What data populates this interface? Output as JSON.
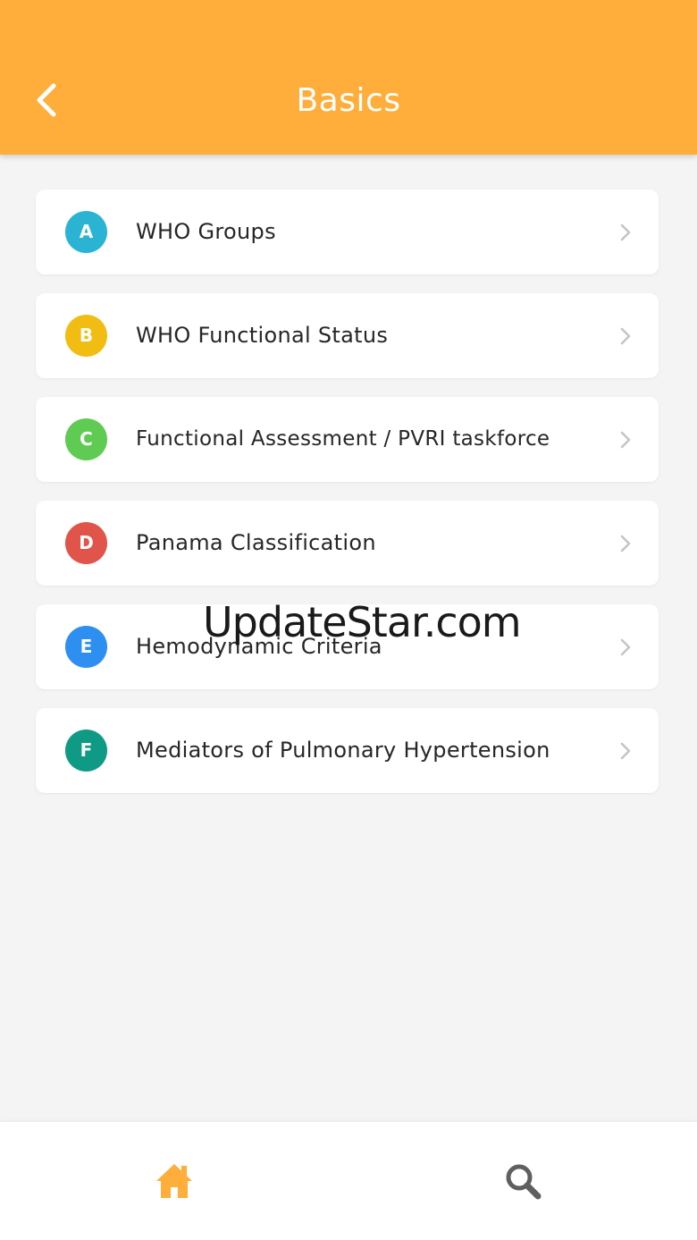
{
  "header": {
    "title": "Basics",
    "back_icon": "chevron-left-icon",
    "background": "#ffae3b"
  },
  "list": {
    "items": [
      {
        "letter": "A",
        "label": "WHO Groups",
        "color": "#2bb3d3"
      },
      {
        "letter": "B",
        "label": "WHO Functional Status",
        "color": "#f2bd12"
      },
      {
        "letter": "C",
        "label": "Functional Assessment / PVRI taskforce",
        "color": "#5fcb52"
      },
      {
        "letter": "D",
        "label": "Panama Classification",
        "color": "#e0544a"
      },
      {
        "letter": "E",
        "label": "Hemodynamic Criteria",
        "color": "#2d8ff0"
      },
      {
        "letter": "F",
        "label": "Mediators of Pulmonary Hypertension",
        "color": "#0f9a86"
      }
    ]
  },
  "watermark": "UpdateStar.com",
  "bottom_nav": {
    "items": [
      {
        "icon": "home-icon",
        "active": true,
        "color": "#ffae3b"
      },
      {
        "icon": "search-icon",
        "active": false,
        "color": "#5f5f5f"
      }
    ]
  }
}
